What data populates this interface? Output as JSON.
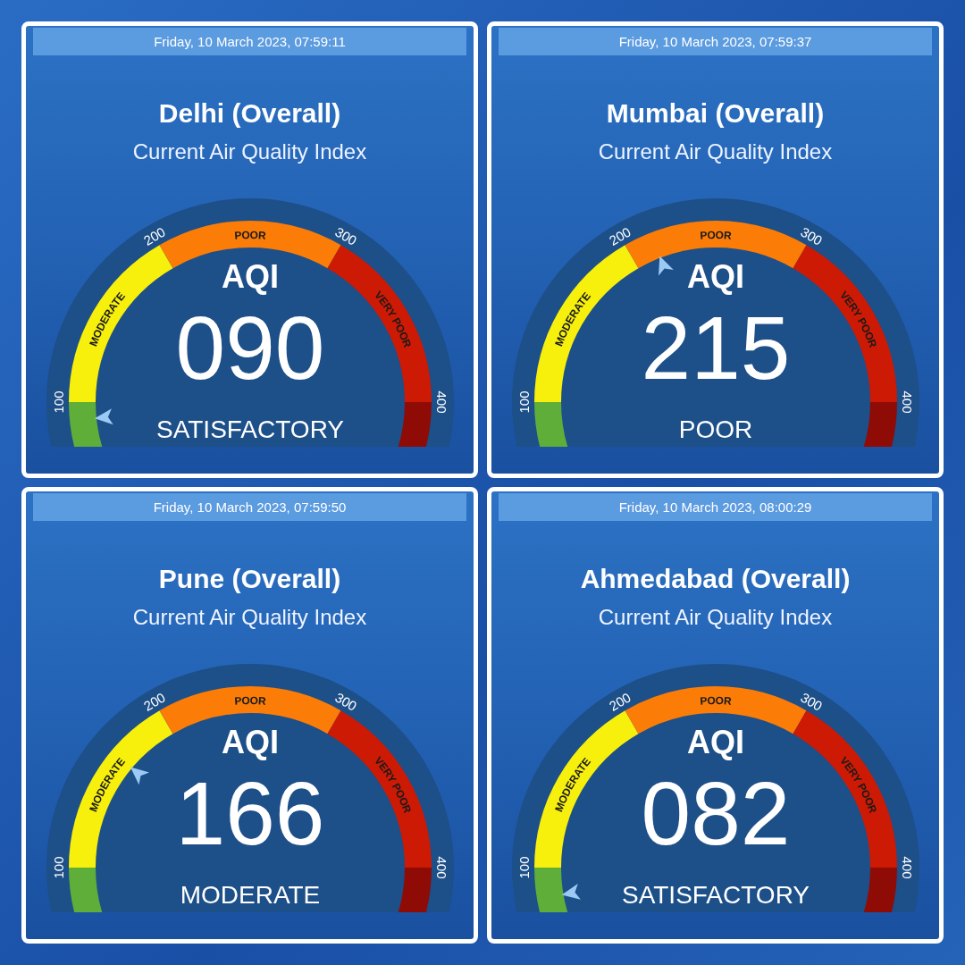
{
  "panels": [
    {
      "timestamp": "Friday, 10 March 2023, 07:59:11",
      "title": "Delhi (Overall)",
      "subtitle": "Current Air Quality Index",
      "gauge": {
        "bands": [
          {
            "color": "#5fae3a"
          },
          {
            "label": "MODERATE",
            "color": "#f7ef0c"
          },
          {
            "label": "POOR",
            "color": "#fb7d07"
          },
          {
            "label": "VERY POOR",
            "color": "#cc1a05"
          },
          {
            "color": "#8f0b06"
          }
        ],
        "ticks": [
          "100",
          "200",
          "300",
          "400"
        ],
        "heading": "AQI",
        "value": "090",
        "category": "SATISFACTORY"
      }
    },
    {
      "timestamp": "Friday, 10 March 2023, 07:59:37",
      "title": "Mumbai (Overall)",
      "subtitle": "Current Air Quality Index",
      "gauge": {
        "bands": [
          {
            "color": "#5fae3a"
          },
          {
            "label": "MODERATE",
            "color": "#f7ef0c"
          },
          {
            "label": "POOR",
            "color": "#fb7d07"
          },
          {
            "label": "VERY POOR",
            "color": "#cc1a05"
          },
          {
            "color": "#8f0b06"
          }
        ],
        "ticks": [
          "100",
          "200",
          "300",
          "400"
        ],
        "heading": "AQI",
        "value": "215",
        "category": "POOR"
      }
    },
    {
      "timestamp": "Friday, 10 March 2023, 07:59:50",
      "title": "Pune (Overall)",
      "subtitle": "Current Air Quality Index",
      "gauge": {
        "bands": [
          {
            "color": "#5fae3a"
          },
          {
            "label": "MODERATE",
            "color": "#f7ef0c"
          },
          {
            "label": "POOR",
            "color": "#fb7d07"
          },
          {
            "label": "VERY POOR",
            "color": "#cc1a05"
          },
          {
            "color": "#8f0b06"
          }
        ],
        "ticks": [
          "100",
          "200",
          "300",
          "400"
        ],
        "heading": "AQI",
        "value": "166",
        "category": "MODERATE"
      }
    },
    {
      "timestamp": "Friday, 10 March 2023, 08:00:29",
      "title": "Ahmedabad (Overall)",
      "subtitle": "Current Air Quality Index",
      "gauge": {
        "bands": [
          {
            "color": "#5fae3a"
          },
          {
            "label": "MODERATE",
            "color": "#f7ef0c"
          },
          {
            "label": "POOR",
            "color": "#fb7d07"
          },
          {
            "label": "VERY POOR",
            "color": "#cc1a05"
          },
          {
            "color": "#8f0b06"
          }
        ],
        "ticks": [
          "100",
          "200",
          "300",
          "400"
        ],
        "heading": "AQI",
        "value": "082",
        "category": "SATISFACTORY"
      }
    }
  ]
}
